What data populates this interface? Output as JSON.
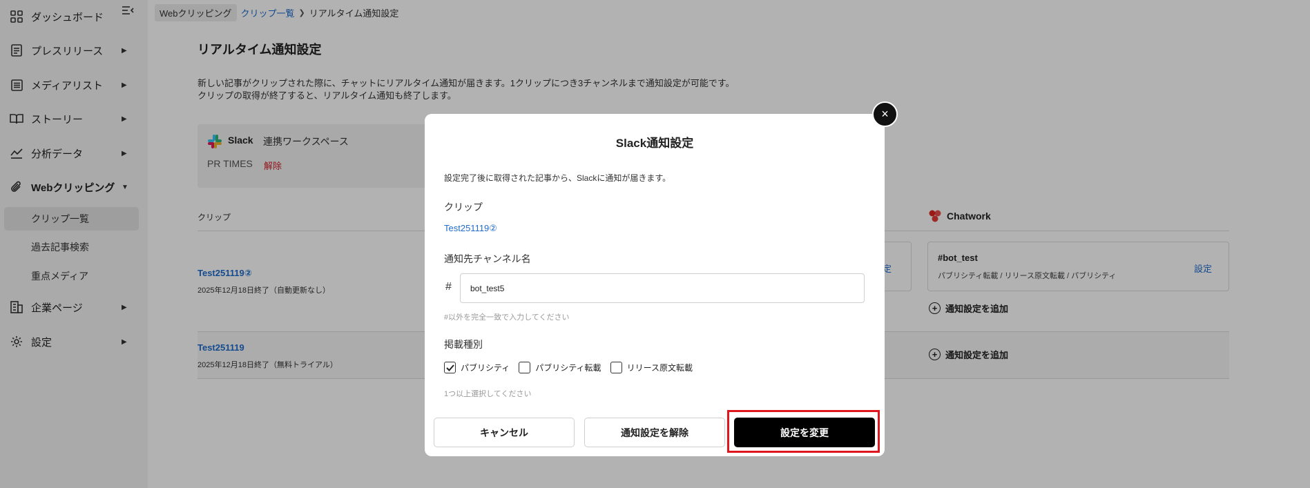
{
  "sidebar": {
    "items": [
      {
        "label": "ダッシュボード",
        "icon": "dashboard-icon"
      },
      {
        "label": "プレスリリース",
        "icon": "document-icon"
      },
      {
        "label": "メディアリスト",
        "icon": "list-icon"
      },
      {
        "label": "ストーリー",
        "icon": "book-icon"
      },
      {
        "label": "分析データ",
        "icon": "chart-icon"
      },
      {
        "label": "Webクリッピング",
        "icon": "paperclip-icon"
      },
      {
        "label": "企業ページ",
        "icon": "building-icon"
      },
      {
        "label": "設定",
        "icon": "gear-icon"
      }
    ],
    "sub_items": [
      "クリップ一覧",
      "過去記事検索",
      "重点メディア"
    ]
  },
  "breadcrumb": {
    "root": "Webクリッピング",
    "link": "クリップ一覧",
    "current": "リアルタイム通知設定"
  },
  "page": {
    "title": "リアルタイム通知設定",
    "desc_line1": "新しい記事がクリップされた際に、チャットにリアルタイム通知が届きます。1クリップにつき3チャンネルまで通知設定が可能です。",
    "desc_line2": "クリップの取得が終了すると、リアルタイム通知も終了します。"
  },
  "slack_card": {
    "name": "Slack",
    "workspace_label": "連携ワークスペース",
    "org": "PR TIMES",
    "unlink": "解除"
  },
  "table": {
    "clip_header": "クリップ",
    "chatwork_header": "Chatwork",
    "rows": [
      {
        "name": "Test251119②",
        "sub": "2025年12月18日終了（自動更新なし）"
      },
      {
        "name": "Test251119",
        "sub": "2025年12月18日終了（無料トライアル）"
      }
    ],
    "left_set": "定",
    "chatwork_card": {
      "channel": "#bot_test",
      "tags": "パブリシティ転載 / リリース原文転載 / パブリシティ",
      "set": "設定"
    },
    "add_label": "通知設定を追加"
  },
  "modal": {
    "title": "Slack通知設定",
    "desc": "設定完了後に取得された記事から、Slackに通知が届きます。",
    "clip_label": "クリップ",
    "clip_value": "Test251119②",
    "channel_label": "通知先チャンネル名",
    "hash": "#",
    "channel_value": "bot_test5",
    "channel_hint": "#以外を完全一致で入力してください",
    "type_label": "掲載種別",
    "checkboxes": [
      {
        "label": "パブリシティ",
        "checked": true
      },
      {
        "label": "パブリシティ転載",
        "checked": false
      },
      {
        "label": "リリース原文転載",
        "checked": false
      }
    ],
    "type_hint": "1つ以上選択してください",
    "cancel": "キャンセル",
    "remove": "通知設定を解除",
    "submit": "設定を変更",
    "close": "×"
  },
  "colors": {
    "accent_link": "#1e6ccc",
    "danger": "#d0202a",
    "highlight": "#e0161f",
    "primary_button": "#000000"
  }
}
